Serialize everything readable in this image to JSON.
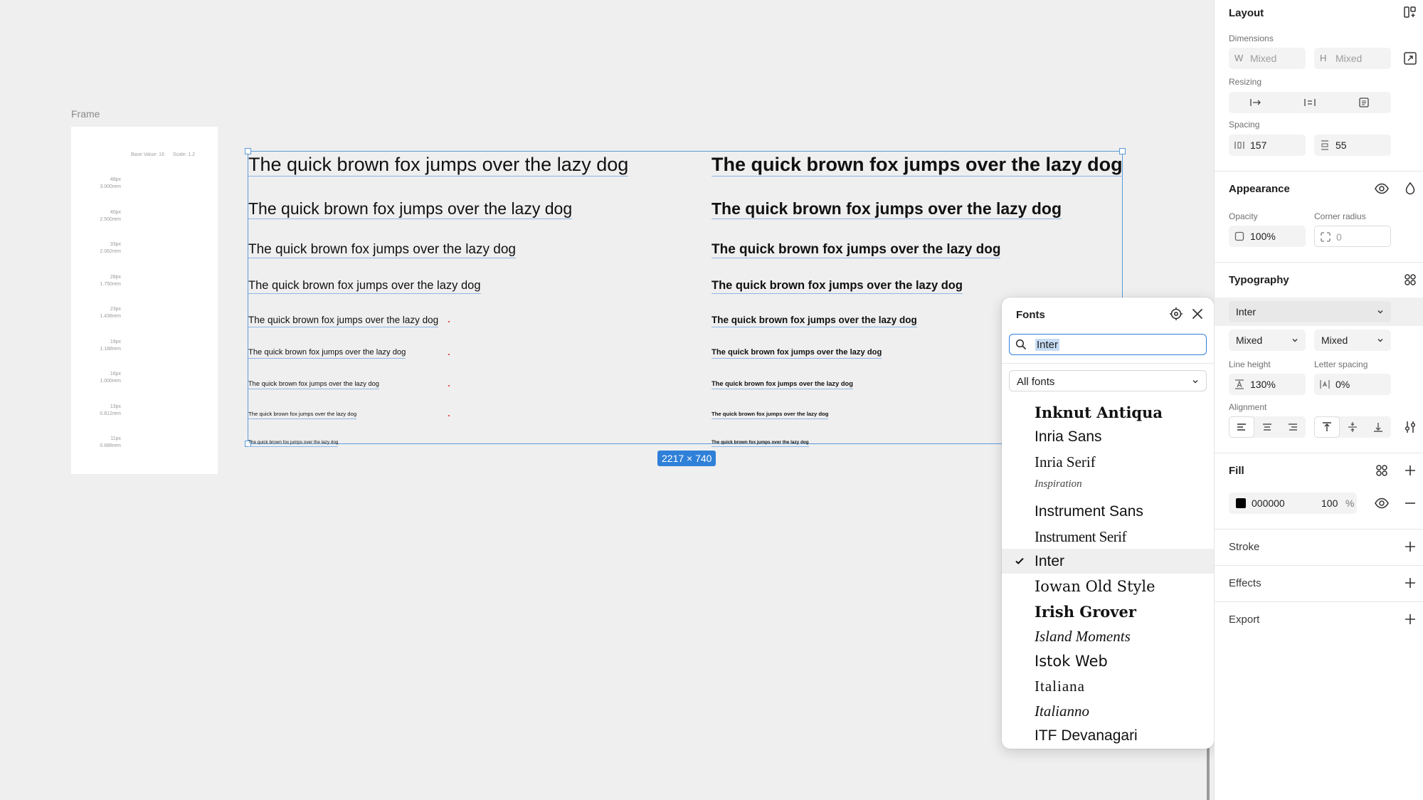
{
  "canvas": {
    "frame_label": "Frame",
    "frame_meta": {
      "base_value": "Base Value: 16",
      "scale": "Scale: 1.2"
    },
    "scale_items": [
      {
        "px": "48px",
        "rem": "3.000rem"
      },
      {
        "px": "40px",
        "rem": "2.500rem"
      },
      {
        "px": "33px",
        "rem": "2.062rem"
      },
      {
        "px": "28px",
        "rem": "1.750rem"
      },
      {
        "px": "23px",
        "rem": "1.438rem"
      },
      {
        "px": "19px",
        "rem": "1.188rem"
      },
      {
        "px": "16px",
        "rem": "1.000rem"
      },
      {
        "px": "13px",
        "rem": "0.812rem"
      },
      {
        "px": "11px",
        "rem": "0.688rem"
      }
    ],
    "sample_text": "The quick brown fox jumps over the lazy dog",
    "size_badge": "2217 × 740"
  },
  "fonts_panel": {
    "title": "Fonts",
    "search_value": "Inter",
    "filter": "All fonts",
    "items": [
      {
        "name": "Inknut Antiqua",
        "selected": false
      },
      {
        "name": "Inria Sans",
        "selected": false
      },
      {
        "name": "Inria Serif",
        "selected": false
      },
      {
        "name": "Inspiration",
        "selected": false
      },
      {
        "name": "Instrument Sans",
        "selected": false
      },
      {
        "name": "Instrument Serif",
        "selected": false
      },
      {
        "name": "Inter",
        "selected": true
      },
      {
        "name": "Iowan Old Style",
        "selected": false
      },
      {
        "name": "Irish Grover",
        "selected": false
      },
      {
        "name": "Island Moments",
        "selected": false
      },
      {
        "name": "Istok Web",
        "selected": false
      },
      {
        "name": "Italiana",
        "selected": false
      },
      {
        "name": "Italianno",
        "selected": false
      },
      {
        "name": "ITF Devanagari",
        "selected": false
      }
    ]
  },
  "props": {
    "layout": {
      "title": "Layout",
      "dimensions_label": "Dimensions",
      "w_prefix": "W",
      "w_value": "Mixed",
      "h_prefix": "H",
      "h_value": "Mixed",
      "resizing_label": "Resizing",
      "spacing_label": "Spacing",
      "spacing_h": "157",
      "spacing_v": "55"
    },
    "appearance": {
      "title": "Appearance",
      "opacity_label": "Opacity",
      "opacity_value": "100%",
      "radius_label": "Corner radius",
      "radius_value": "0"
    },
    "typography": {
      "title": "Typography",
      "font": "Inter",
      "weight": "Mixed",
      "size": "Mixed",
      "line_height_label": "Line height",
      "line_height_value": "130%",
      "letter_spacing_label": "Letter spacing",
      "letter_spacing_value": "0%",
      "alignment_label": "Alignment"
    },
    "fill": {
      "title": "Fill",
      "hex": "000000",
      "opacity": "100",
      "percent": "%"
    },
    "stroke": {
      "title": "Stroke"
    },
    "effects": {
      "title": "Effects"
    },
    "export": {
      "title": "Export"
    }
  },
  "colors": {
    "selection": "#5c9ad8",
    "accent": "#2f80d8",
    "fill_swatch": "#000000"
  }
}
